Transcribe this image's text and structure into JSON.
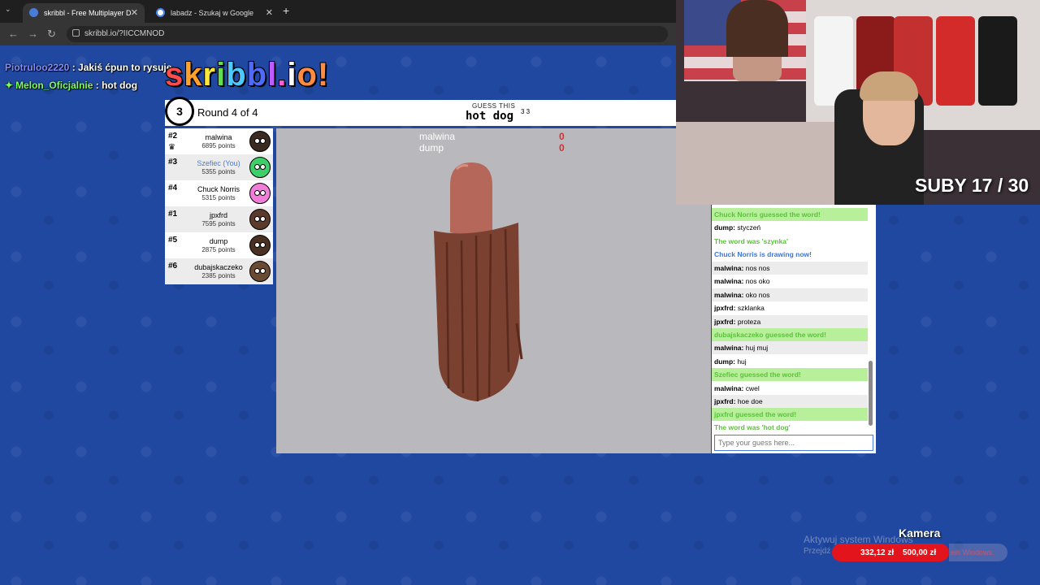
{
  "browser": {
    "tabs": [
      {
        "title": "skribbl - Free Multiplayer D",
        "active": true
      },
      {
        "title": "labadz - Szukaj w Google",
        "active": false
      }
    ],
    "new_tab": "+",
    "url": "skribbl.io/?IICCMNOD"
  },
  "overlay_chat": [
    {
      "user": "Piotruloo2220",
      "text": " : Jakiś ćpun to rysuje"
    },
    {
      "user": "Melon_Oficjalnie",
      "text": " : hot dog"
    }
  ],
  "logo": {
    "letters": [
      "s",
      "k",
      "r",
      "i",
      "b",
      "b",
      "l",
      ".",
      "i",
      "o"
    ],
    "suffix": "!"
  },
  "game": {
    "timer": "3",
    "round": "Round 4 of 4",
    "guess_hint": "GUESS THIS",
    "word": "hot dog",
    "word_count": "3 3"
  },
  "players": [
    {
      "rank": "#2",
      "name": "malwina",
      "points": "6895 points",
      "avatar_color": "#3a2a1f",
      "you": false,
      "crown": true
    },
    {
      "rank": "#3",
      "name": "Szefiec (You)",
      "points": "5355 points",
      "avatar_color": "#3fcf6a",
      "you": true,
      "crown": false
    },
    {
      "rank": "#4",
      "name": "Chuck Norris",
      "points": "5315 points",
      "avatar_color": "#f07ed8",
      "you": false,
      "crown": false
    },
    {
      "rank": "#1",
      "name": "jpxfrd",
      "points": "7595 points",
      "avatar_color": "#5b3a2a",
      "you": false,
      "crown": false
    },
    {
      "rank": "#5",
      "name": "dump",
      "points": "2875 points",
      "avatar_color": "#4a3020",
      "you": false,
      "crown": false
    },
    {
      "rank": "#6",
      "name": "dubajskaczeko",
      "points": "2385 points",
      "avatar_color": "#6b4a32",
      "you": false,
      "crown": false
    }
  ],
  "canvas_overlay": [
    {
      "name": "malwina",
      "score": "0"
    },
    {
      "name": "dump",
      "score": "0"
    }
  ],
  "chat": [
    {
      "user": "",
      "text": "Chuck Norris guessed the word!",
      "style": "greenbg"
    },
    {
      "user": "dump:",
      "text": " styczeń",
      "style": "plain"
    },
    {
      "user": "",
      "text": "The word was 'szynka'",
      "style": "green"
    },
    {
      "user": "",
      "text": "Chuck Norris is drawing now!",
      "style": "blue"
    },
    {
      "user": "malwina:",
      "text": " nos nos",
      "style": "alt"
    },
    {
      "user": "malwina:",
      "text": " nos oko",
      "style": "plain"
    },
    {
      "user": "malwina:",
      "text": " oko nos",
      "style": "alt"
    },
    {
      "user": "jpxfrd:",
      "text": " szklanka",
      "style": "plain"
    },
    {
      "user": "jpxfrd:",
      "text": " proteza",
      "style": "alt"
    },
    {
      "user": "",
      "text": "dubajskaczeko guessed the word!",
      "style": "greenbg"
    },
    {
      "user": "malwina:",
      "text": " huj muj",
      "style": "alt"
    },
    {
      "user": "dump:",
      "text": " huj",
      "style": "plain"
    },
    {
      "user": "",
      "text": "Szefiec guessed the word!",
      "style": "greenbg"
    },
    {
      "user": "malwina:",
      "text": " cwel",
      "style": "plain"
    },
    {
      "user": "jpxfrd:",
      "text": " hoe doe",
      "style": "alt"
    },
    {
      "user": "",
      "text": "jpxfrd guessed the word!",
      "style": "greenbg"
    },
    {
      "user": "",
      "text": "The word was 'hot dog'",
      "style": "green"
    }
  ],
  "guess_input": {
    "placeholder": "Type your guess here..."
  },
  "stream": {
    "suby": "SUBY 17 / 30",
    "kamera": "Kamera",
    "watermark_line1": "Aktywuj system Windows",
    "watermark_line2": "Przejdź",
    "donation_current": "332,12 zł",
    "donation_goal": "500,00 zł",
    "donation_tail": "ein Windows."
  },
  "colors": {
    "page_bg": "#2148a0",
    "accent_blue": "#4a7bd9",
    "guess_green": "#5bc23c",
    "donation_red": "#e3141b"
  }
}
